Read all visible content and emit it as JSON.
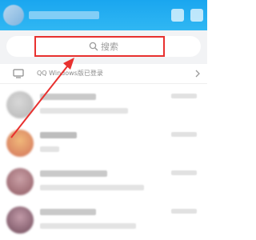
{
  "search": {
    "placeholder": "搜索"
  },
  "pc_banner": {
    "label": "QQ Windows版已登录"
  },
  "colors": {
    "header": "#1aa6ef",
    "highlight": "#e8312f",
    "search_bg": "#f2f3f5"
  },
  "icons": {
    "search": "search-icon",
    "monitor": "monitor-icon",
    "chevron": "chevron-right-icon",
    "annotation_arrow": "arrow-icon"
  }
}
